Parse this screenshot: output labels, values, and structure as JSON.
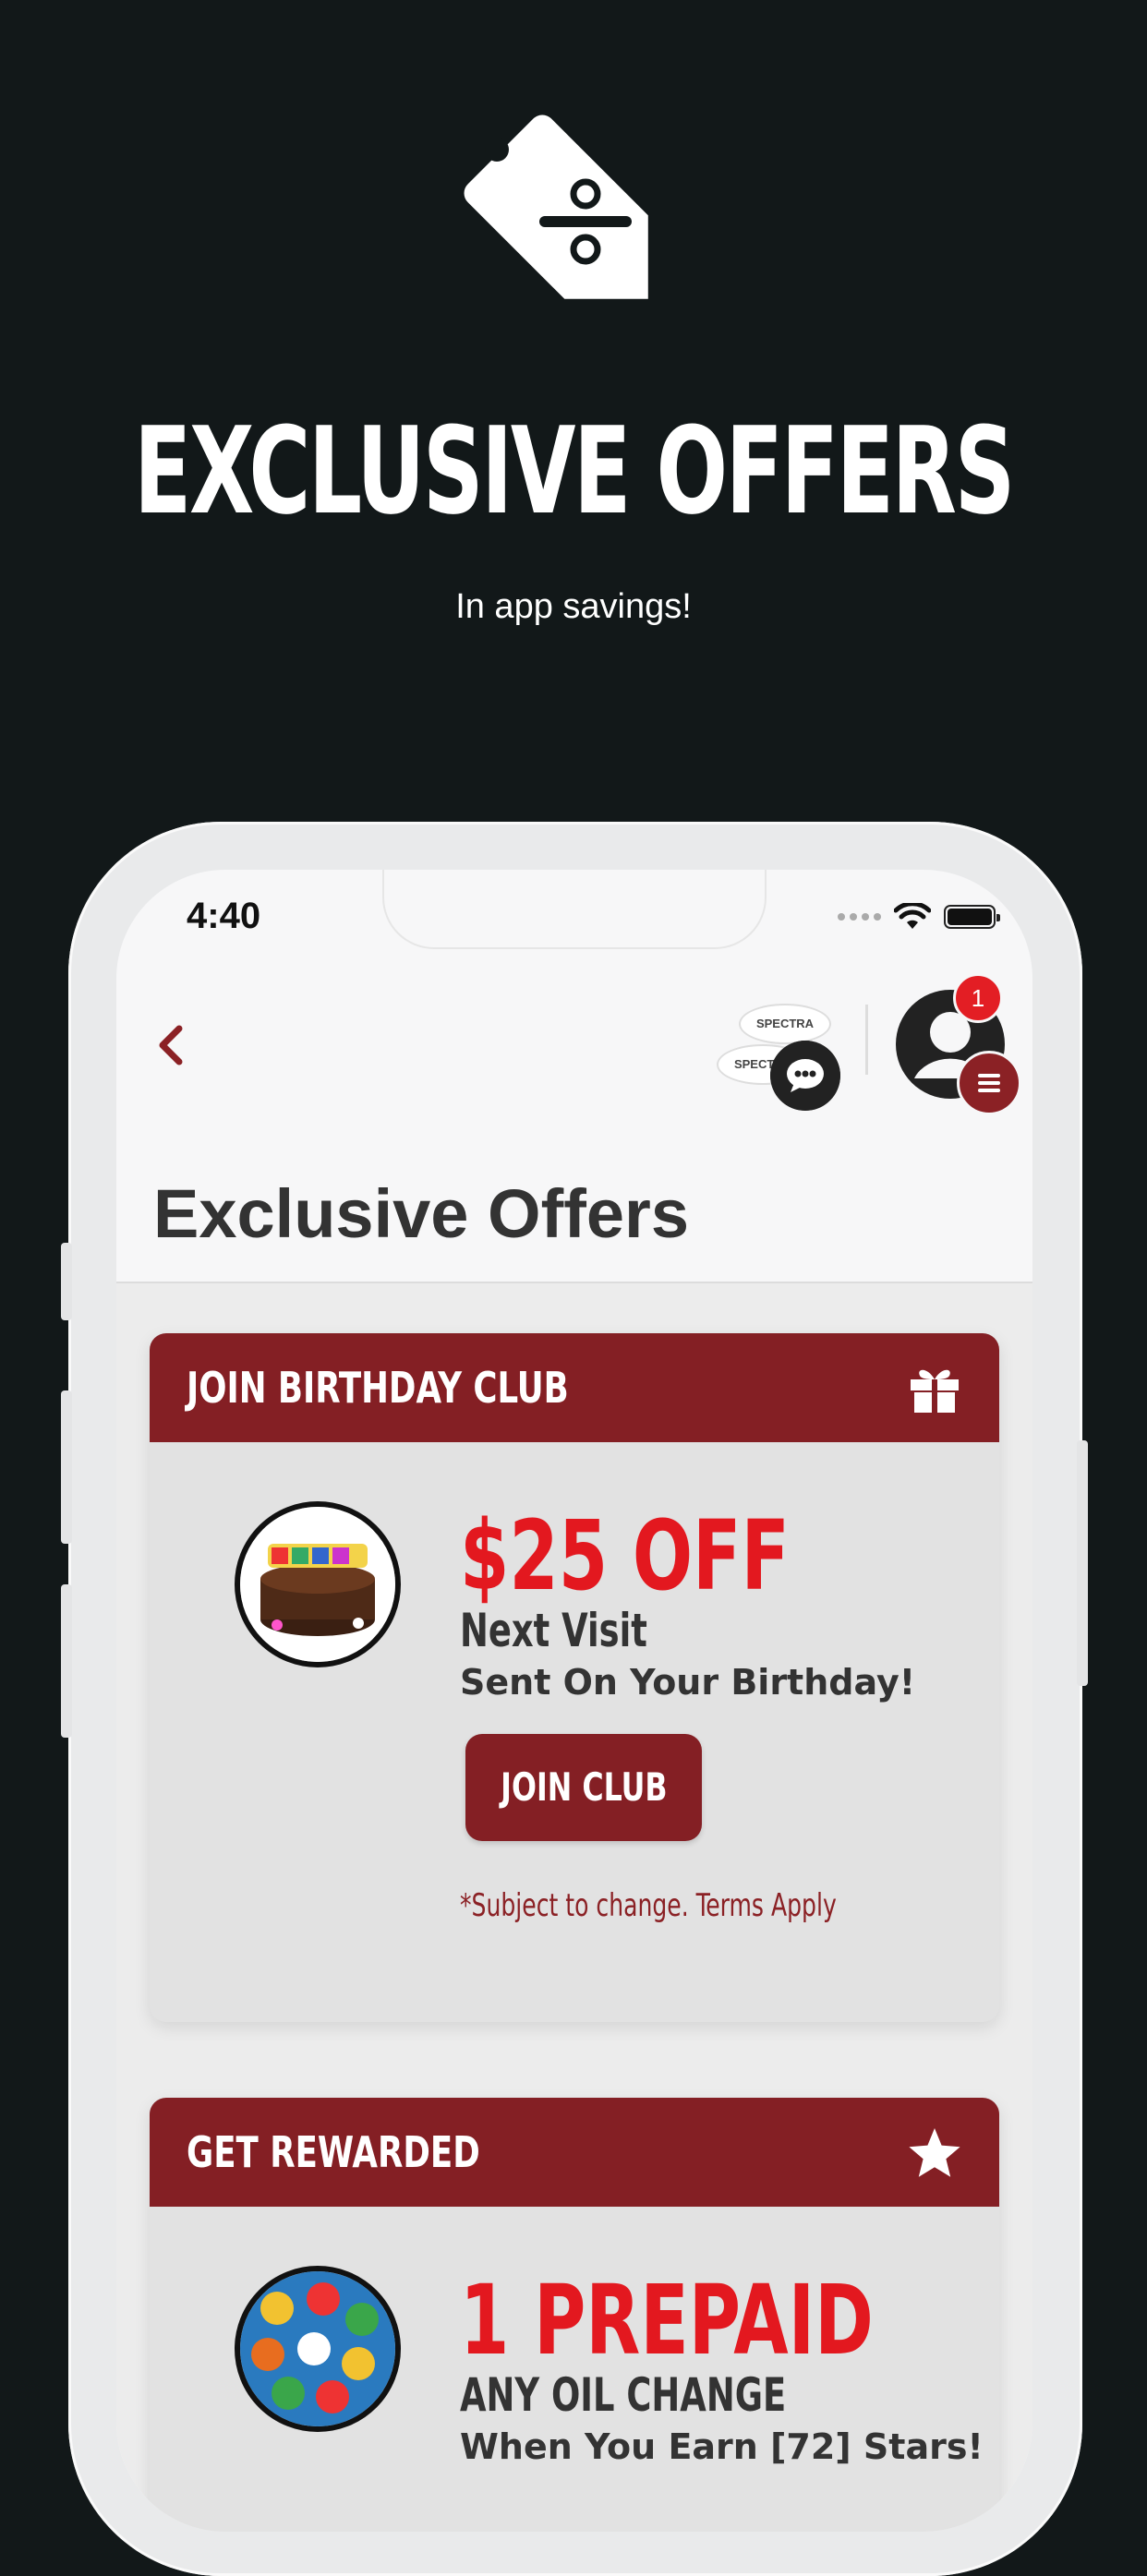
{
  "promo": {
    "title": "EXCLUSIVE OFFERS",
    "subtitle": "In app savings!"
  },
  "status_bar": {
    "time": "4:40"
  },
  "header": {
    "logo_text_top": "SPECTRA",
    "logo_text_bottom": "SPECTRA",
    "notification_count": "1"
  },
  "page": {
    "title": "Exclusive Offers"
  },
  "cards": [
    {
      "header": "JOIN BIRTHDAY CLUB",
      "icon": "gift-icon",
      "image_label": "BIRTHDAY HAPPY",
      "offer": "$25 OFF",
      "subtitle": "Next Visit",
      "detail": "Sent On Your Birthday!",
      "button": "JOIN CLUB",
      "terms": "*Subject to change. Terms Apply"
    },
    {
      "header": "GET REWARDED",
      "icon": "star-icon",
      "offer": "1 PREPAID",
      "subtitle": "ANY OIL CHANGE",
      "detail": "When You Earn [72] Stars!"
    }
  ],
  "colors": {
    "background": "#121819",
    "accent": "#841f24",
    "offer_red": "#e3181f",
    "badge_red": "#e31e24"
  }
}
